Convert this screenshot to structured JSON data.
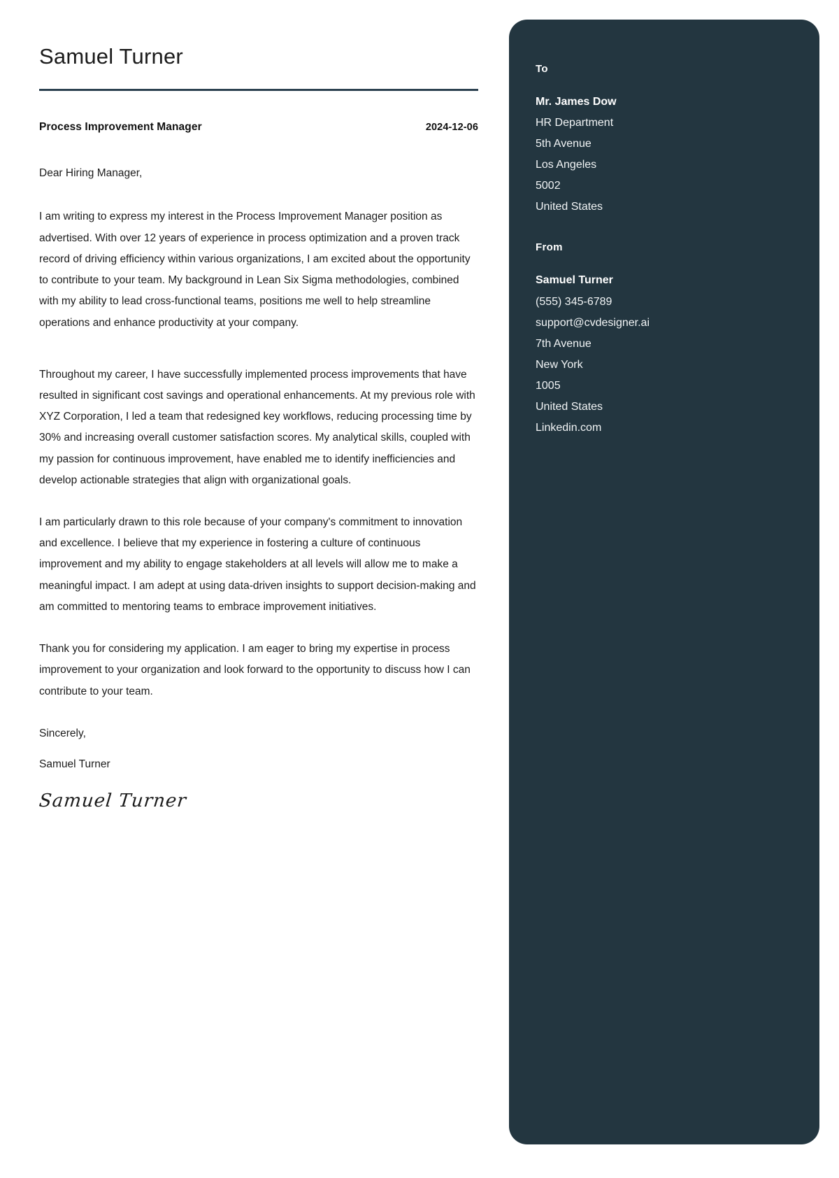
{
  "document": {
    "candidate_name": "Samuel Turner",
    "job_title": "Process Improvement Manager",
    "date": "2024-12-06",
    "salutation": "Dear Hiring Manager,",
    "paragraphs": [
      "I am writing to express my interest in the Process Improvement Manager position as advertised. With over 12 years of experience in process optimization and a proven track record of driving efficiency within various organizations, I am excited about the opportunity to contribute to your team. My background in Lean Six Sigma methodologies, combined with my ability to lead cross-functional teams, positions me well to help streamline operations and enhance productivity at your company.",
      "Throughout my career, I have successfully implemented process improvements that have resulted in significant cost savings and operational enhancements. At my previous role with XYZ Corporation, I led a team that redesigned key workflows, reducing processing time by 30% and increasing overall customer satisfaction scores. My analytical skills, coupled with my passion for continuous improvement, have enabled me to identify inefficiencies and develop actionable strategies that align with organizational goals.",
      "I am particularly drawn to this role because of your company's commitment to innovation and excellence. I believe that my experience in fostering a culture of continuous improvement and my ability to engage stakeholders at all levels will allow me to make a meaningful impact. I am adept at using data-driven insights to support decision-making and am committed to mentoring teams to embrace improvement initiatives.",
      "Thank you for considering my application. I am eager to bring my expertise in process improvement to your organization and look forward to the opportunity to discuss how I can contribute to your team."
    ],
    "closing_word": "Sincerely,",
    "closing_name": "Samuel Turner",
    "signature": "Samuel Turner"
  },
  "sidebar": {
    "to_heading": "To",
    "recipient": {
      "name": "Mr. James Dow",
      "department": "HR Department",
      "street": "5th Avenue",
      "city": "Los Angeles",
      "postal_code": "5002",
      "country": "United States"
    },
    "from_heading": "From",
    "sender": {
      "name": "Samuel Turner",
      "phone": "(555) 345-6789",
      "email": "support@cvdesigner.ai",
      "street": "7th Avenue",
      "city": "New York",
      "postal_code": "1005",
      "country": "United States",
      "website": "Linkedin.com"
    }
  },
  "colors": {
    "sidebar_background": "#233640",
    "rule": "#2c4150",
    "body_text": "#1c1c1c",
    "page_background": "#ffffff"
  }
}
